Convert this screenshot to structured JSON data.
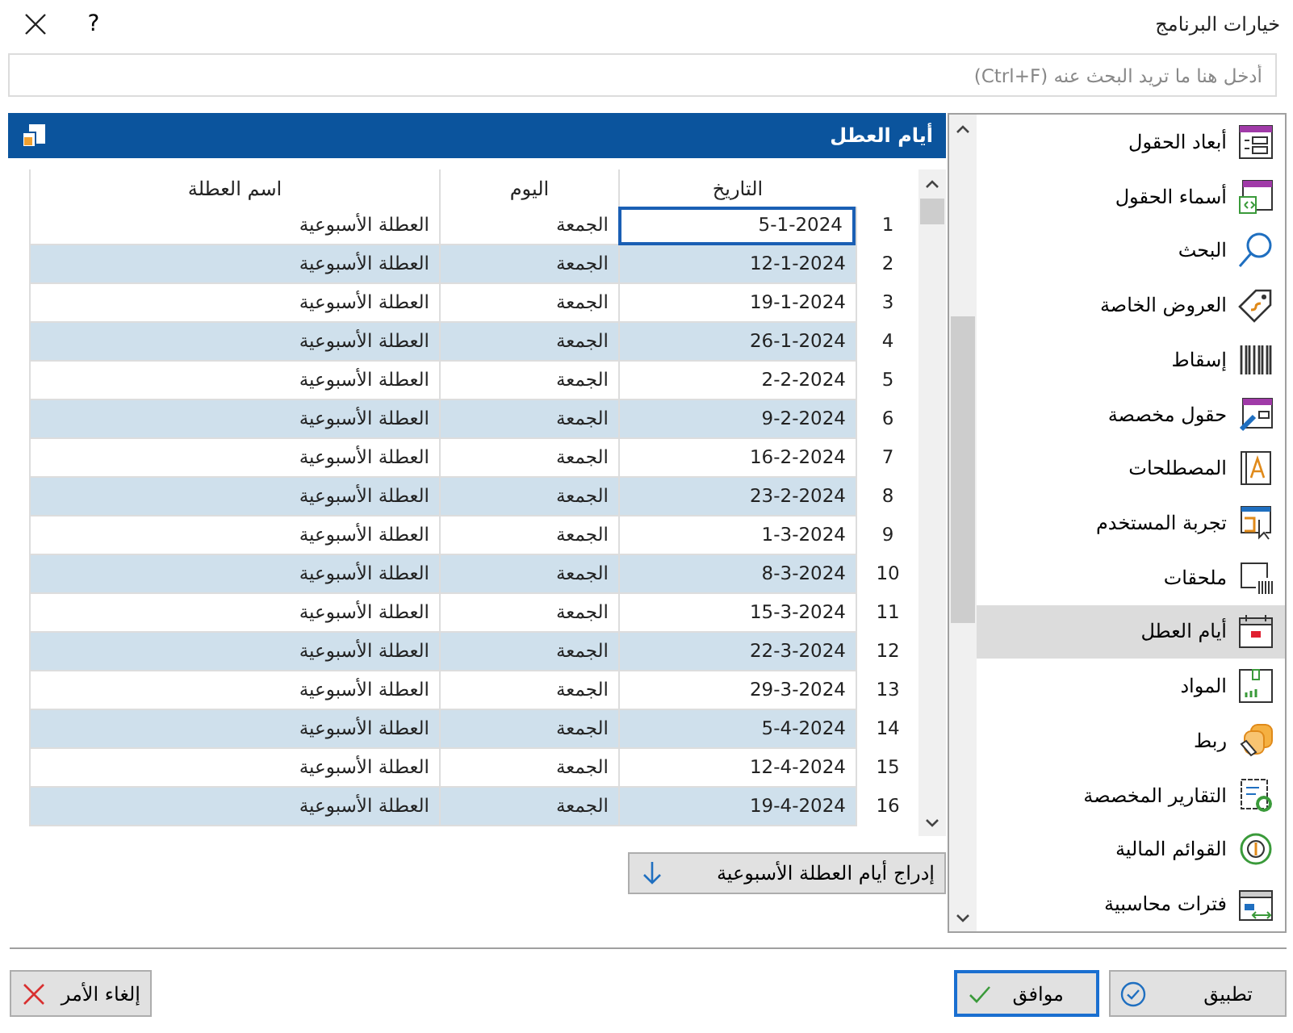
{
  "window": {
    "title": "خيارات البرنامج",
    "help": "?"
  },
  "search": {
    "placeholder": "أدخل هنا ما تريد البحث عنه (Ctrl+F)"
  },
  "sidebar": {
    "items": [
      {
        "label": "أبعاد الحقول",
        "selected": false
      },
      {
        "label": "أسماء الحقول",
        "selected": false
      },
      {
        "label": "البحث",
        "selected": false
      },
      {
        "label": "العروض  الخاصة",
        "selected": false
      },
      {
        "label": "إسقاط",
        "selected": false
      },
      {
        "label": "حقول مخصصة",
        "selected": false
      },
      {
        "label": "المصطلحات",
        "selected": false
      },
      {
        "label": "تجربة المستخدم",
        "selected": false
      },
      {
        "label": "ملحقات",
        "selected": false
      },
      {
        "label": "أيام العطل",
        "selected": true
      },
      {
        "label": "المواد",
        "selected": false
      },
      {
        "label": "ربط",
        "selected": false
      },
      {
        "label": "التقارير المخصصة",
        "selected": false
      },
      {
        "label": "القوائم المالية",
        "selected": false
      },
      {
        "label": "فترات محاسبية",
        "selected": false
      }
    ]
  },
  "panel": {
    "title": "أيام العطل"
  },
  "table": {
    "columns": [
      "التاريخ",
      "اليوم",
      "اسم العطلة"
    ],
    "rows": [
      {
        "number": "1",
        "date": "5-1-2024",
        "day": "الجمعة",
        "name": "العطلة الأسبوعية",
        "selected": true
      },
      {
        "number": "2",
        "date": "12-1-2024",
        "day": "الجمعة",
        "name": "العطلة الأسبوعية",
        "selected": false
      },
      {
        "number": "3",
        "date": "19-1-2024",
        "day": "الجمعة",
        "name": "العطلة الأسبوعية",
        "selected": false
      },
      {
        "number": "4",
        "date": "26-1-2024",
        "day": "الجمعة",
        "name": "العطلة الأسبوعية",
        "selected": false
      },
      {
        "number": "5",
        "date": "2-2-2024",
        "day": "الجمعة",
        "name": "العطلة الأسبوعية",
        "selected": false
      },
      {
        "number": "6",
        "date": "9-2-2024",
        "day": "الجمعة",
        "name": "العطلة الأسبوعية",
        "selected": false
      },
      {
        "number": "7",
        "date": "16-2-2024",
        "day": "الجمعة",
        "name": "العطلة الأسبوعية",
        "selected": false
      },
      {
        "number": "8",
        "date": "23-2-2024",
        "day": "الجمعة",
        "name": "العطلة الأسبوعية",
        "selected": false
      },
      {
        "number": "9",
        "date": "1-3-2024",
        "day": "الجمعة",
        "name": "العطلة الأسبوعية",
        "selected": false
      },
      {
        "number": "10",
        "date": "8-3-2024",
        "day": "الجمعة",
        "name": "العطلة الأسبوعية",
        "selected": false
      },
      {
        "number": "11",
        "date": "15-3-2024",
        "day": "الجمعة",
        "name": "العطلة الأسبوعية",
        "selected": false
      },
      {
        "number": "12",
        "date": "22-3-2024",
        "day": "الجمعة",
        "name": "العطلة الأسبوعية",
        "selected": false
      },
      {
        "number": "13",
        "date": "29-3-2024",
        "day": "الجمعة",
        "name": "العطلة الأسبوعية",
        "selected": false
      },
      {
        "number": "14",
        "date": "5-4-2024",
        "day": "الجمعة",
        "name": "العطلة الأسبوعية",
        "selected": false
      },
      {
        "number": "15",
        "date": "12-4-2024",
        "day": "الجمعة",
        "name": "العطلة الأسبوعية",
        "selected": false
      },
      {
        "number": "16",
        "date": "19-4-2024",
        "day": "الجمعة",
        "name": "العطلة الأسبوعية",
        "selected": false
      }
    ]
  },
  "insert_button": "إدراج أيام العطلة الأسبوعية",
  "buttons": {
    "apply": "تطبيق",
    "ok": "موافق",
    "cancel": "إلغاء الأمر"
  }
}
